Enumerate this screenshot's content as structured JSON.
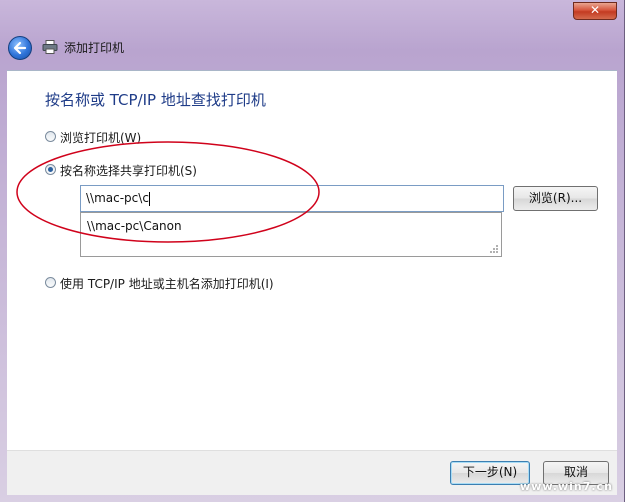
{
  "window": {
    "title": "添加打印机",
    "close_label": "✕"
  },
  "heading": "按名称或 TCP/IP 地址查找打印机",
  "options": {
    "browse_label": "浏览打印机(W)",
    "by_name_label": "按名称选择共享打印机(S)",
    "by_tcpip_label": "使用 TCP/IP 地址或主机名添加打印机(I)",
    "selected": "by_name"
  },
  "name_input": {
    "value": "\\\\mac-pc\\c"
  },
  "browse_button": "浏览(R)...",
  "suggestions": [
    "\\\\mac-pc\\Canon"
  ],
  "footer": {
    "next_label": "下一步(N)",
    "cancel_label": "取消"
  },
  "watermark": "www.win7.cn",
  "colors": {
    "heading": "#1f3c88",
    "highlight_ellipse": "#d0021b"
  },
  "icons": {
    "back": "back-arrow-icon",
    "printer": "printer-icon",
    "close": "close-icon"
  }
}
